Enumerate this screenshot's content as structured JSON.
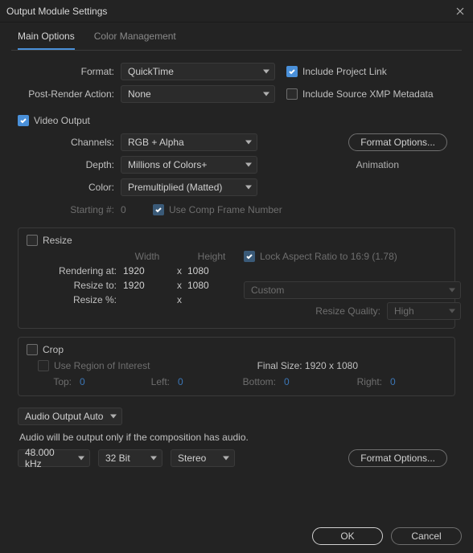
{
  "window": {
    "title": "Output Module Settings"
  },
  "tabs": {
    "main": "Main Options",
    "color": "Color Management"
  },
  "format": {
    "label": "Format:",
    "value": "QuickTime",
    "include_project_link": "Include Project Link",
    "post_render_label": "Post-Render Action:",
    "post_render_value": "None",
    "include_xmp": "Include Source XMP Metadata"
  },
  "video": {
    "header": "Video Output",
    "channels_label": "Channels:",
    "channels_value": "RGB + Alpha",
    "format_options": "Format Options...",
    "depth_label": "Depth:",
    "depth_value": "Millions of Colors+",
    "codec_name": "Animation",
    "color_label": "Color:",
    "color_value": "Premultiplied (Matted)",
    "starting_label": "Starting #:",
    "starting_value": "0",
    "use_comp_frame": "Use Comp Frame Number"
  },
  "resize": {
    "header": "Resize",
    "width_label": "Width",
    "height_label": "Height",
    "lock_ar": "Lock Aspect Ratio to 16:9 (1.78)",
    "rendering_at_label": "Rendering at:",
    "render_w": "1920",
    "render_h": "1080",
    "resize_to_label": "Resize to:",
    "resize_w": "1920",
    "resize_h": "1080",
    "preset": "Custom",
    "resize_pct_label": "Resize %:",
    "quality_label": "Resize Quality:",
    "quality_value": "High",
    "x": "x"
  },
  "crop": {
    "header": "Crop",
    "use_roi": "Use Region of Interest",
    "final_size_label": "Final Size: 1920 x 1080",
    "top_label": "Top:",
    "top_val": "0",
    "left_label": "Left:",
    "left_val": "0",
    "bottom_label": "Bottom:",
    "bottom_val": "0",
    "right_label": "Right:",
    "right_val": "0"
  },
  "audio": {
    "mode": "Audio Output Auto",
    "note": "Audio will be output only if the composition has audio.",
    "rate": "48.000 kHz",
    "depth": "32 Bit",
    "channels": "Stereo",
    "format_options": "Format Options..."
  },
  "buttons": {
    "ok": "OK",
    "cancel": "Cancel"
  }
}
